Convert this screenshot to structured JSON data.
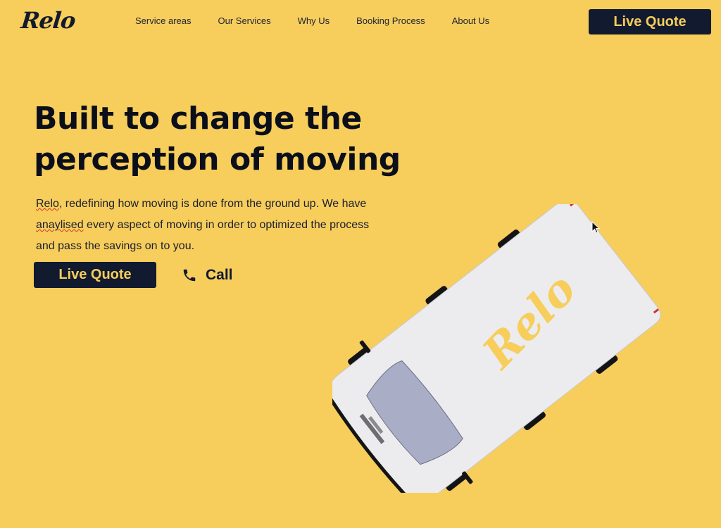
{
  "header": {
    "logo_text": "Relo",
    "nav": [
      {
        "label": "Service areas"
      },
      {
        "label": "Our Services"
      },
      {
        "label": "Why Us"
      },
      {
        "label": "Booking Process"
      },
      {
        "label": "About Us"
      }
    ],
    "quote_label": "Live Quote"
  },
  "hero": {
    "headline_line1": "Built to change the",
    "headline_line2": "perception of moving",
    "desc": {
      "brand": "Relo",
      "part1": ", redefining how moving is done from the ground up. We have",
      "misspelled": "anaylised",
      "part2": " every aspect of moving in order to optimized the process",
      "part3": "and pass the savings on to you."
    },
    "quote_label": "Live Quote",
    "call_label": "Call"
  },
  "van": {
    "brand_text": "Relo"
  },
  "colors": {
    "background": "#f7cd5c",
    "button": "#111a2e",
    "button_text": "#f7cd5c",
    "van_body": "#ececee",
    "windshield": "#a9adc6"
  }
}
